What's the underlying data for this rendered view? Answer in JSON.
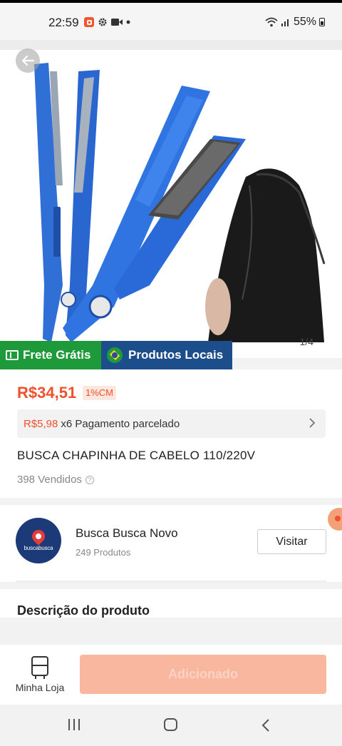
{
  "status_bar": {
    "time": "22:59",
    "battery": "55%"
  },
  "gallery": {
    "counter": "1/4"
  },
  "promos": {
    "free_shipping": "Frete Grátis",
    "local_products": "Produtos Locais"
  },
  "product": {
    "price": "R$34,51",
    "cm_badge": "1%CM",
    "installment_amount": "R$5,98",
    "installment_text": "x6 Pagamento parcelado",
    "title": "BUSCA CHAPINHA DE CABELO 110/220V",
    "sold": "398 Vendidos"
  },
  "store": {
    "logo_text": "buscabusca",
    "name": "Busca Busca Novo",
    "products": "249 Produtos",
    "visit_label": "Visitar"
  },
  "description": {
    "title": "Descrição do produto"
  },
  "bottom_bar": {
    "my_store_label": "Minha Loja",
    "add_label": "Adicionado"
  },
  "colors": {
    "accent": "#f0502b",
    "promo_green": "#1f9a3a",
    "promo_blue": "#1c4e8c",
    "button_disabled": "#f9b79f",
    "iron_blue": "#2f6fd6"
  }
}
